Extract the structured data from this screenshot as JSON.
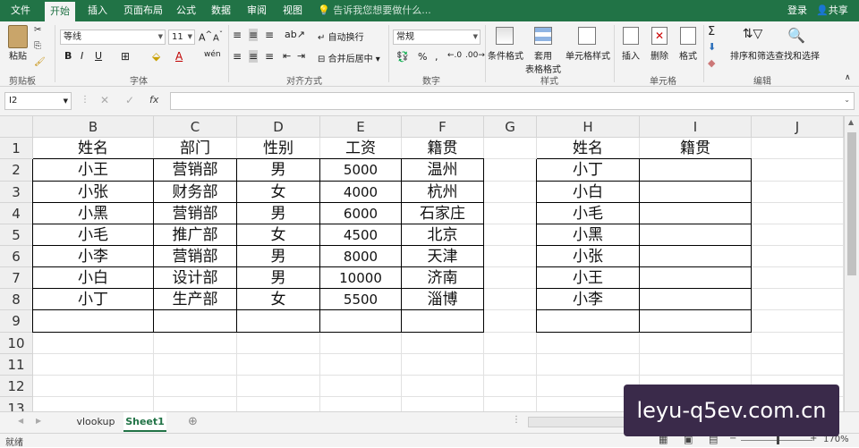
{
  "menubar": {
    "tabs": [
      "文件",
      "开始",
      "插入",
      "页面布局",
      "公式",
      "数据",
      "审阅",
      "视图"
    ],
    "active": "开始",
    "tellme": "告诉我您想要做什么...",
    "login": "登录",
    "share": "共享"
  },
  "ribbon": {
    "clipboard": {
      "paste": "粘贴",
      "group": "剪贴板"
    },
    "font": {
      "name": "等线",
      "size": "11",
      "group": "字体"
    },
    "alignment": {
      "wrap": "自动换行",
      "merge": "合并后居中",
      "group": "对齐方式"
    },
    "number": {
      "format": "常规",
      "group": "数字"
    },
    "styles": {
      "cond": "条件格式",
      "table1": "套用",
      "table2": "表格格式",
      "cellstyle": "单元格样式",
      "group": "样式"
    },
    "cells": {
      "insert": "插入",
      "delete": "删除",
      "format": "格式",
      "group": "单元格"
    },
    "editing": {
      "sort": "排序和筛选",
      "find": "查找和选择",
      "group": "编辑"
    }
  },
  "formula_bar": {
    "name_box": "I2",
    "fx": "fx"
  },
  "sheet": {
    "columns": [
      "B",
      "C",
      "D",
      "E",
      "F",
      "G",
      "H",
      "I",
      "J"
    ],
    "rows": [
      "1",
      "2",
      "3",
      "4",
      "5",
      "6",
      "7",
      "8",
      "9",
      "10",
      "11",
      "12",
      "13"
    ],
    "table1": {
      "headers": [
        "姓名",
        "部门",
        "性别",
        "工资",
        "籍贯"
      ],
      "rows": [
        [
          "小王",
          "营销部",
          "男",
          "5000",
          "温州"
        ],
        [
          "小张",
          "财务部",
          "女",
          "4000",
          "杭州"
        ],
        [
          "小黑",
          "营销部",
          "男",
          "6000",
          "石家庄"
        ],
        [
          "小毛",
          "推广部",
          "女",
          "4500",
          "北京"
        ],
        [
          "小李",
          "营销部",
          "男",
          "8000",
          "天津"
        ],
        [
          "小白",
          "设计部",
          "男",
          "10000",
          "济南"
        ],
        [
          "小丁",
          "生产部",
          "女",
          "5500",
          "淄博"
        ]
      ]
    },
    "table2": {
      "headers": [
        "姓名",
        "籍贯"
      ],
      "rows": [
        [
          "小丁",
          ""
        ],
        [
          "小白",
          ""
        ],
        [
          "小毛",
          ""
        ],
        [
          "小黑",
          ""
        ],
        [
          "小张",
          ""
        ],
        [
          "小王",
          ""
        ],
        [
          "小李",
          ""
        ]
      ]
    }
  },
  "sheet_tabs": [
    "vlookup",
    "Sheet1"
  ],
  "active_sheet": "Sheet1",
  "status": {
    "ready": "就绪",
    "zoom": "170%"
  },
  "watermark": "leyu-q5ev.com.cn"
}
